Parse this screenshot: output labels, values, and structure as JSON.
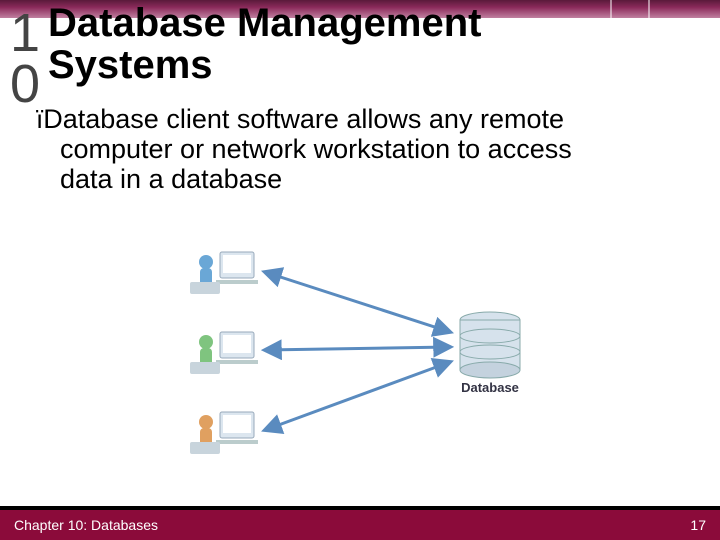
{
  "chapter_number": "10",
  "title_line1": "Database Management",
  "title_line2": "Systems",
  "bullet_symbol": "ï",
  "body_line1": "Database client software allows any remote",
  "body_line2": "computer or network workstation to access",
  "body_line3": "data in a database",
  "diagram": {
    "label": "Database",
    "client_colors": [
      "#6aa7d6",
      "#7fc47f",
      "#e0a060"
    ]
  },
  "footer": {
    "left": "Chapter 10: Databases",
    "right": "17"
  }
}
